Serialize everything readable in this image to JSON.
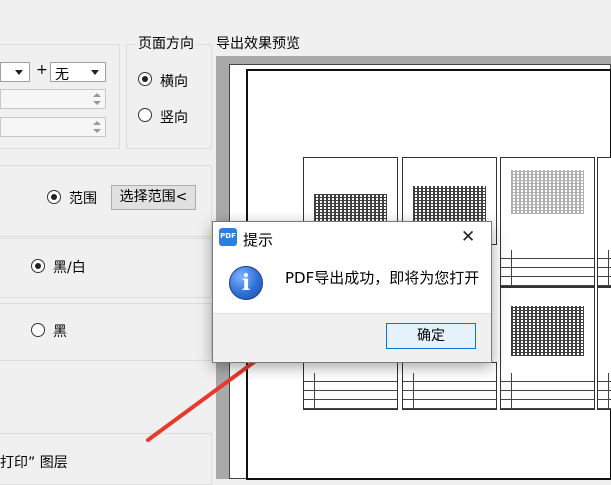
{
  "orientation": {
    "heading": "页面方向",
    "options": [
      {
        "label": "横向",
        "selected": true
      },
      {
        "label": "竖向",
        "selected": false
      }
    ]
  },
  "preview": {
    "heading": "导出效果预览"
  },
  "size_row": {
    "plus": "+",
    "combo2_value": "无"
  },
  "range": {
    "radio_label": "范围",
    "select_button": "选择范围<"
  },
  "color_mode": {
    "bw_label": "黑/白",
    "black_label": "黑"
  },
  "layer_text": "打印” 图层",
  "dialog": {
    "title": "提示",
    "message": "PDF导出成功，即将为您打开",
    "ok": "确定",
    "close_glyph": "✕",
    "info_glyph": "i"
  },
  "colors": {
    "arrow": "#e8392d",
    "button_border": "#0078d7",
    "preview_bg": "#a9a9a9"
  }
}
